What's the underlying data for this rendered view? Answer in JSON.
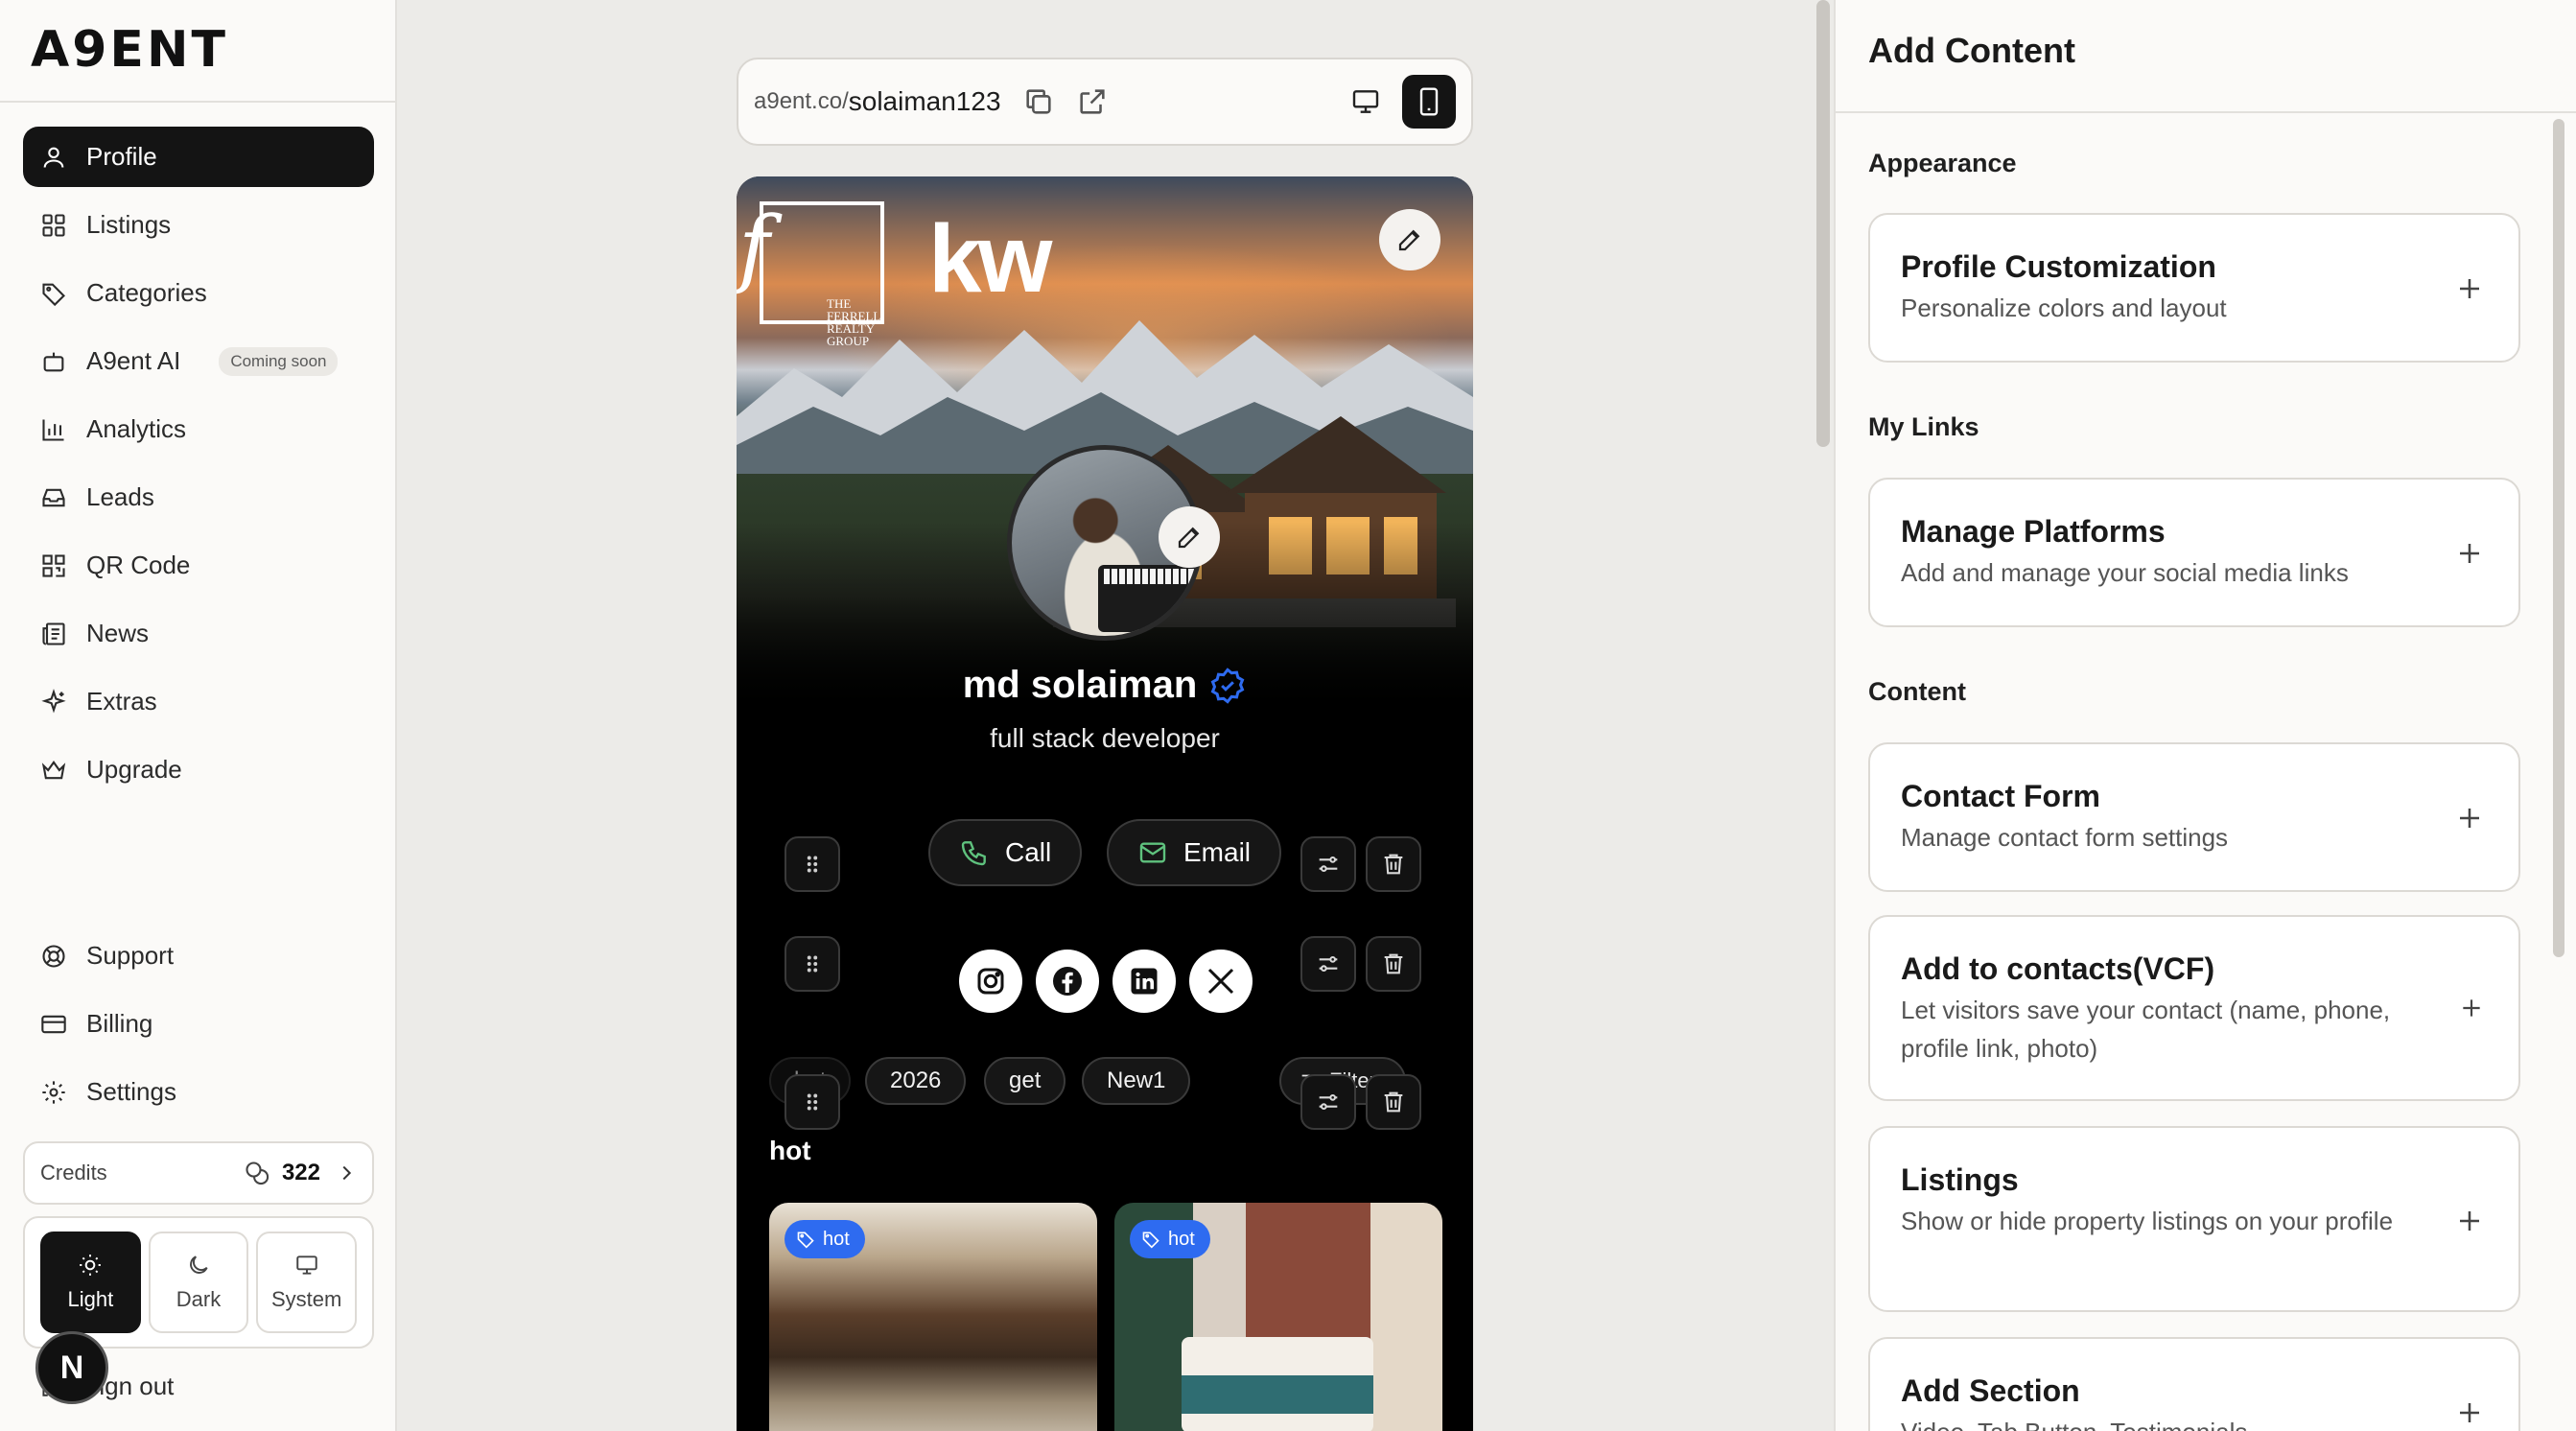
{
  "brand": {
    "logo_text": "A9ENT"
  },
  "sidebar": {
    "items": [
      {
        "label": "Profile",
        "icon": "user-icon",
        "active": true
      },
      {
        "label": "Listings",
        "icon": "grid-icon"
      },
      {
        "label": "Categories",
        "icon": "tag-icon"
      },
      {
        "label": "A9ent AI",
        "icon": "bot-icon",
        "badge": "Coming soon"
      },
      {
        "label": "Analytics",
        "icon": "bar-chart-icon"
      },
      {
        "label": "Leads",
        "icon": "inbox-icon"
      },
      {
        "label": "QR Code",
        "icon": "qr-code-icon"
      },
      {
        "label": "News",
        "icon": "newspaper-icon"
      },
      {
        "label": "Extras",
        "icon": "sparkles-icon"
      },
      {
        "label": "Upgrade",
        "icon": "crown-icon"
      }
    ],
    "bottom_items": [
      {
        "label": "Support",
        "icon": "lifebuoy-icon"
      },
      {
        "label": "Billing",
        "icon": "credit-card-icon"
      },
      {
        "label": "Settings",
        "icon": "gear-icon"
      }
    ],
    "credits": {
      "label": "Credits",
      "value": "322"
    },
    "theme": {
      "options": [
        "Light",
        "Dark",
        "System"
      ],
      "selected": "Light"
    },
    "signout_label": "Sign out",
    "avatar_initial": "N"
  },
  "preview": {
    "url_prefix": "a9ent.co/",
    "url_user": "solaiman123",
    "device_selected": "mobile",
    "cover": {
      "logo_letter": "f",
      "logo_small_1": "THE FERRELL",
      "logo_small_2": "REALTY GROUP",
      "brand_mark": "kw"
    },
    "name": "md solaiman",
    "headline": "full stack developer",
    "buttons": {
      "call": "Call",
      "email": "Email"
    },
    "socials": [
      "instagram-icon",
      "facebook-icon",
      "linkedin-icon",
      "x-icon"
    ],
    "chips": [
      "hot",
      "2026",
      "get",
      "New1"
    ],
    "filters_label": "Filters",
    "section_title": "hot",
    "listing_tags": [
      "hot",
      "hot"
    ]
  },
  "panel": {
    "title": "Add Content",
    "sections": [
      {
        "label": "Appearance"
      },
      {
        "label": "My Links"
      },
      {
        "label": "Content"
      }
    ],
    "cards": [
      {
        "title": "Profile Customization",
        "desc": "Personalize colors and layout"
      },
      {
        "title": "Manage Platforms",
        "desc": "Add and manage your social media links"
      },
      {
        "title": "Contact Form",
        "desc": "Manage contact form settings"
      },
      {
        "title": "Add to contacts(VCF)",
        "desc": "Let visitors save your contact (name, phone, profile link, photo)"
      },
      {
        "title": "Listings",
        "desc": "Show or hide property listings on your profile"
      },
      {
        "title": "Add Section",
        "desc": "Video, Tab Button, Testimonials"
      }
    ]
  },
  "colors": {
    "accent_dark": "#141414",
    "verified_blue": "#2e6bf0",
    "tag_blue": "#2e6bf0",
    "call_icon_green": "#5fc27e"
  }
}
